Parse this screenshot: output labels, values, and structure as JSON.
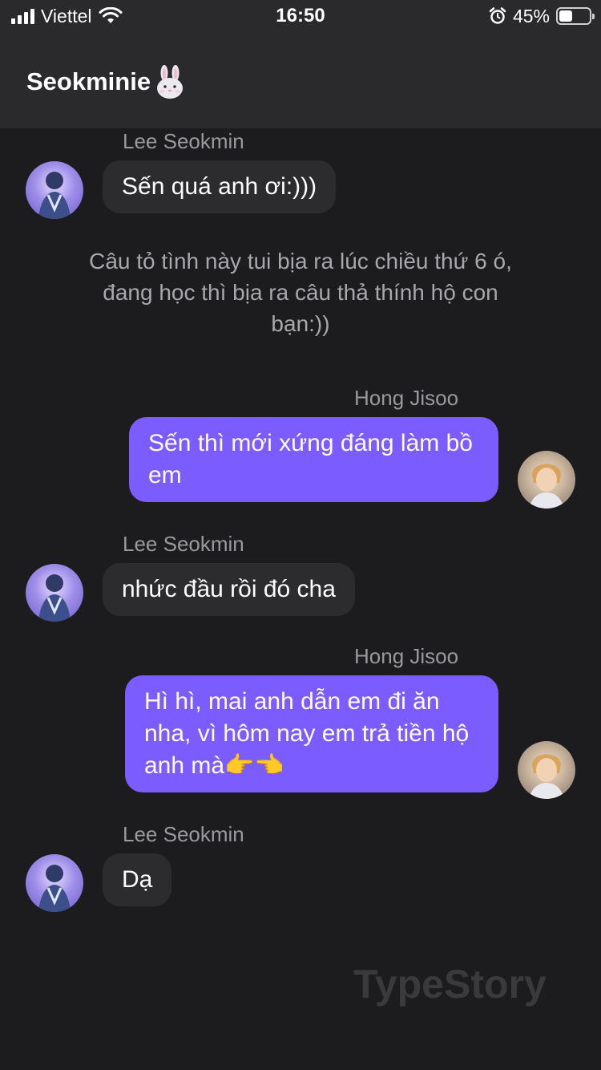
{
  "status_bar": {
    "carrier": "Viettel",
    "time": "16:50",
    "battery_percent_text": "45%",
    "battery_level": 0.45,
    "icons": [
      "signal-icon",
      "wifi-icon",
      "alarm-icon",
      "battery-icon"
    ]
  },
  "header": {
    "title": "Seokminie",
    "emoji": "rabbit-face-icon"
  },
  "messages": [
    {
      "sender": "Lee Seokmin",
      "side": "left",
      "text": "Sến quá anh ơi:)))"
    },
    {
      "type": "system",
      "text": "Câu tỏ tình này tui bịa ra lúc chiều thứ 6 ó, đang học thì bịa ra câu thả thính hộ con bạn:))"
    },
    {
      "sender": "Hong Jisoo",
      "side": "right",
      "text": "Sến thì mới xứng đáng làm bồ em"
    },
    {
      "sender": "Lee Seokmin",
      "side": "left",
      "text": "nhức đầu rồi đó cha"
    },
    {
      "sender": "Hong Jisoo",
      "side": "right",
      "text": "Hì hì, mai anh dẫn em đi ăn nha, vì hôm nay em trả tiền hộ anh mà👉👈"
    },
    {
      "sender": "Lee Seokmin",
      "side": "left",
      "text": "Dạ"
    }
  ],
  "watermark": "TypeStory",
  "colors": {
    "background": "#1c1c1e",
    "bar": "#2a2a2c",
    "incoming_bubble": "#2c2c2e",
    "outgoing_bubble": "#7b5cff",
    "sender_name": "#9a9a9e"
  }
}
